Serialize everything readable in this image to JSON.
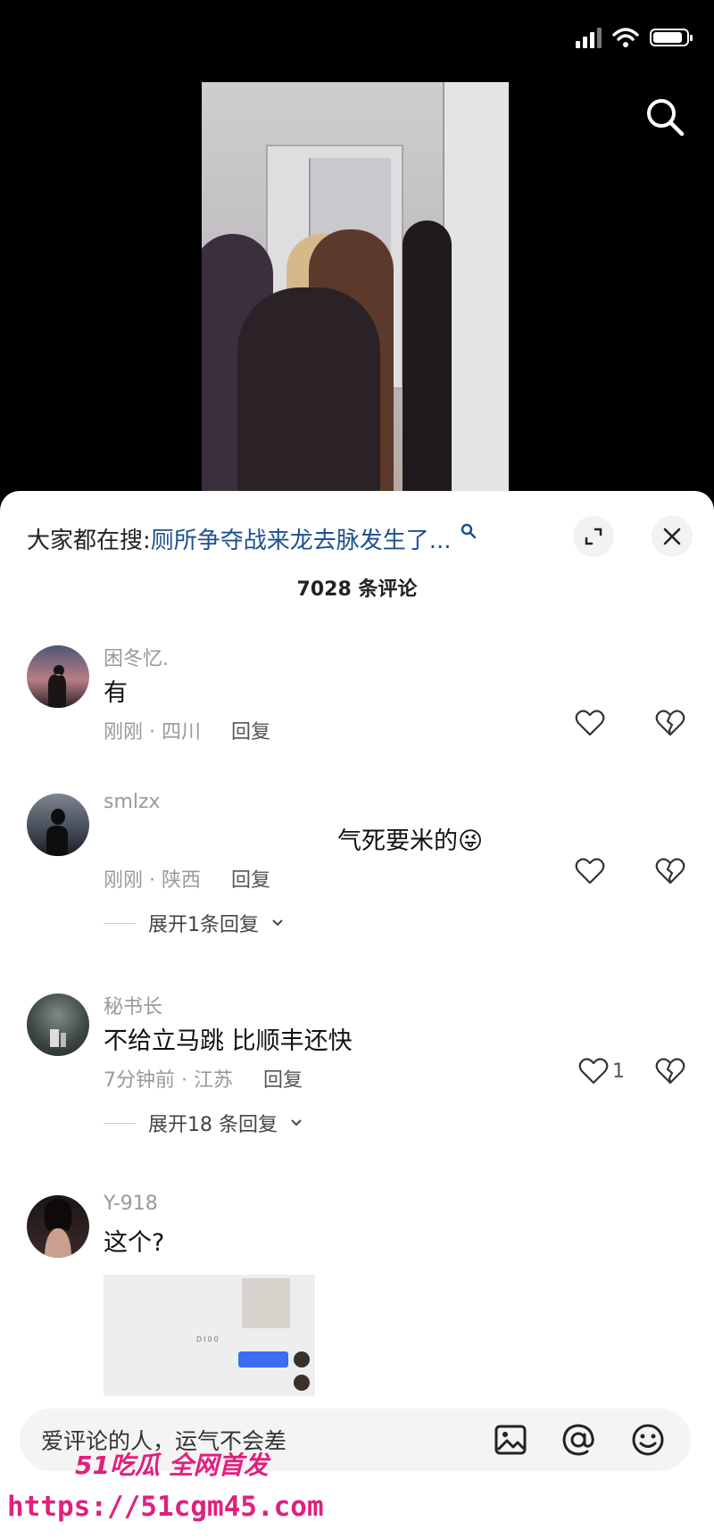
{
  "sheet": {
    "search_prefix": "大家都在搜:",
    "search_query": "厕所争夺战来龙去脉发生了...",
    "comment_count": "7028 条评论"
  },
  "comments": [
    {
      "username": "困冬忆.",
      "text": "有",
      "time_location": "刚刚 · 四川",
      "reply_label": "回复",
      "likes": ""
    },
    {
      "username": "smlzx",
      "text": "气死要米的😜",
      "time_location": "刚刚 · 陕西",
      "reply_label": "回复",
      "likes": "",
      "expand_replies": "展开1条回复"
    },
    {
      "username": "秘书长",
      "text": "不给立马跳 比顺丰还快",
      "time_location": "7分钟前 · 江苏",
      "reply_label": "回复",
      "likes": "1",
      "expand_replies": "展开18 条回复"
    },
    {
      "username": "Y-918",
      "text": "这个?",
      "attachment_text": "DI00",
      "attachment_button": "[[[[[[["
    }
  ],
  "input": {
    "placeholder": "爱评论的人，运气不会差"
  },
  "watermark": {
    "logo": "51吃瓜 全网首发",
    "url": "https://51cgm45.com"
  },
  "icons": [
    "signal-icon",
    "wifi-icon",
    "battery-icon",
    "search-icon",
    "expand-icon",
    "close-icon",
    "heart-icon",
    "broken-heart-icon",
    "chevron-down-icon",
    "image-icon",
    "at-icon",
    "emoji-icon"
  ],
  "colors": {
    "search_query": "#1f4f8f",
    "watermark": "#e0207f",
    "accent_button": "#3b6ff0"
  }
}
